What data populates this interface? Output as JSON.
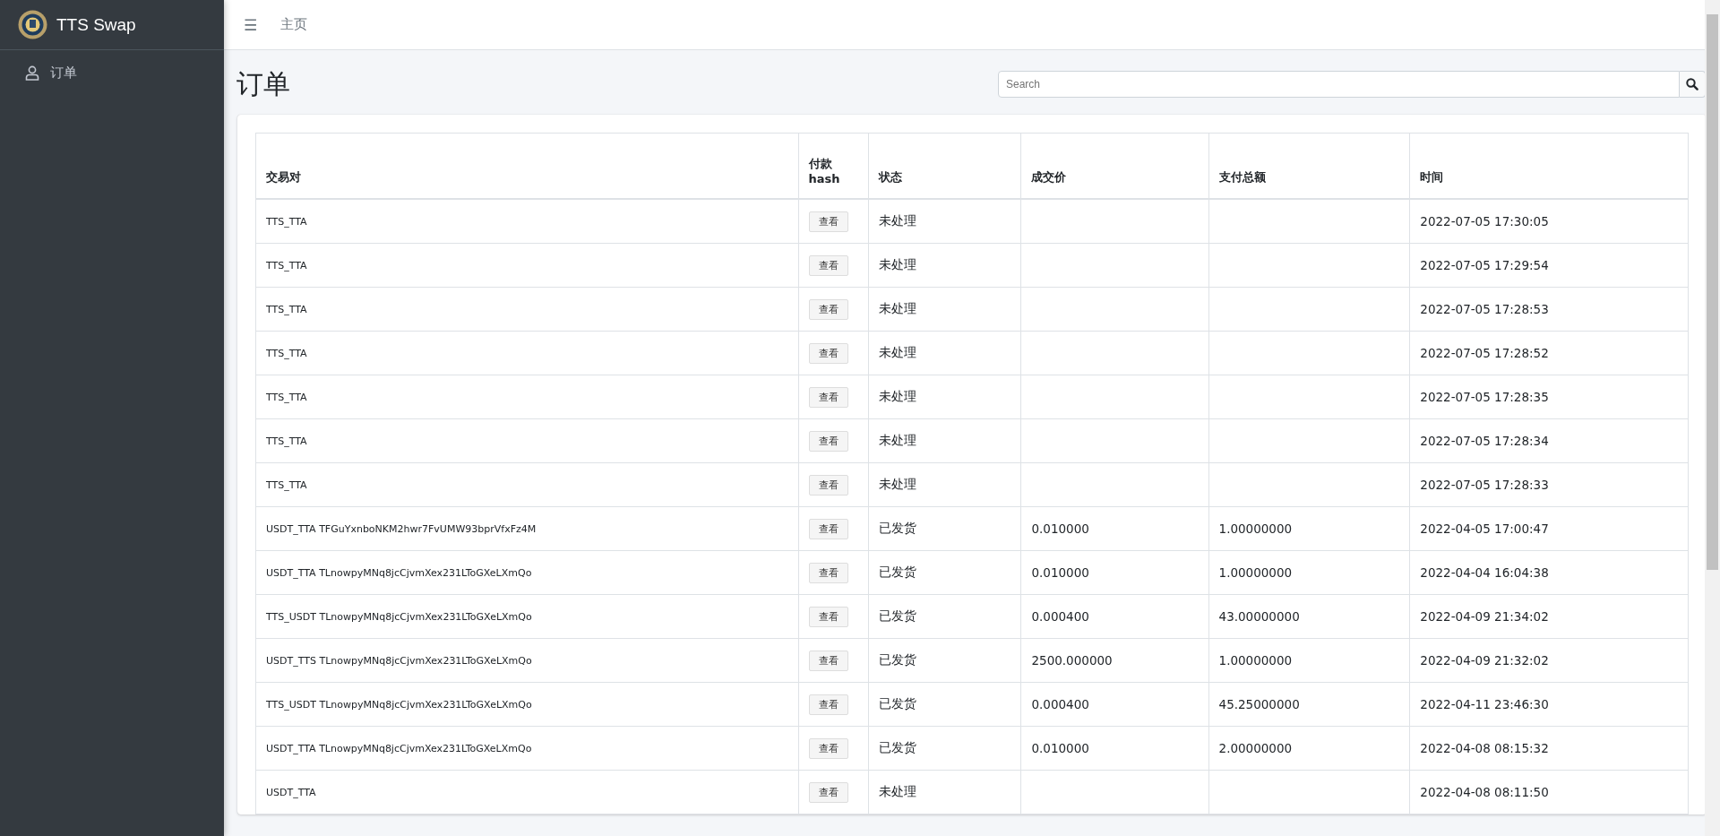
{
  "sidebar": {
    "brand": "TTS Swap",
    "items": [
      {
        "label": "订单",
        "selected": false
      }
    ]
  },
  "navbar": {
    "menu": "☰",
    "links": [
      "主页"
    ]
  },
  "page": {
    "title": "订单",
    "search": {
      "placeholder": "Search"
    }
  },
  "table": {
    "columns": [
      "交易对",
      "付款 hash",
      "状态",
      "成交价",
      "支付总额",
      "时间"
    ],
    "rows": [
      {
        "pair": "TTS_TTA",
        "action": "查看",
        "status": "未处理",
        "price": "",
        "amount": "",
        "time": "2022-07-05 17:30:05"
      },
      {
        "pair": "TTS_TTA",
        "action": "查看",
        "status": "未处理",
        "price": "",
        "amount": "",
        "time": "2022-07-05 17:29:54"
      },
      {
        "pair": "TTS_TTA",
        "action": "查看",
        "status": "未处理",
        "price": "",
        "amount": "",
        "time": "2022-07-05 17:28:53"
      },
      {
        "pair": "TTS_TTA",
        "action": "查看",
        "status": "未处理",
        "price": "",
        "amount": "",
        "time": "2022-07-05 17:28:52"
      },
      {
        "pair": "TTS_TTA",
        "action": "查看",
        "status": "未处理",
        "price": "",
        "amount": "",
        "time": "2022-07-05 17:28:35"
      },
      {
        "pair": "TTS_TTA",
        "action": "查看",
        "status": "未处理",
        "price": "",
        "amount": "",
        "time": "2022-07-05 17:28:34"
      },
      {
        "pair": "TTS_TTA",
        "action": "查看",
        "status": "未处理",
        "price": "",
        "amount": "",
        "time": "2022-07-05 17:28:33"
      },
      {
        "pair": "USDT_TTA TFGuYxnboNKM2hwr7FvUMW93bprVfxFz4M",
        "action": "查看",
        "status": "已发货",
        "price": "0.010000",
        "amount": "1.00000000",
        "time": "2022-04-05 17:00:47"
      },
      {
        "pair": "USDT_TTA TLnowpyMNq8jcCjvmXex231LToGXeLXmQo",
        "action": "查看",
        "status": "已发货",
        "price": "0.010000",
        "amount": "1.00000000",
        "time": "2022-04-04 16:04:38"
      },
      {
        "pair": "TTS_USDT TLnowpyMNq8jcCjvmXex231LToGXeLXmQo",
        "action": "查看",
        "status": "已发货",
        "price": "0.000400",
        "amount": "43.00000000",
        "time": "2022-04-09 21:34:02"
      },
      {
        "pair": "USDT_TTS TLnowpyMNq8jcCjvmXex231LToGXeLXmQo",
        "action": "查看",
        "status": "已发货",
        "price": "2500.000000",
        "amount": "1.00000000",
        "time": "2022-04-09 21:32:02"
      },
      {
        "pair": "TTS_USDT TLnowpyMNq8jcCjvmXex231LToGXeLXmQo",
        "action": "查看",
        "status": "已发货",
        "price": "0.000400",
        "amount": "45.25000000",
        "time": "2022-04-11 23:46:30"
      },
      {
        "pair": "USDT_TTA TLnowpyMNq8jcCjvmXex231LToGXeLXmQo",
        "action": "查看",
        "status": "已发货",
        "price": "0.010000",
        "amount": "2.00000000",
        "time": "2022-04-08 08:15:32"
      },
      {
        "pair": "USDT_TTA",
        "action": "查看",
        "status": "未处理",
        "price": "",
        "amount": "",
        "time": "2022-04-08 08:11:50"
      }
    ]
  }
}
